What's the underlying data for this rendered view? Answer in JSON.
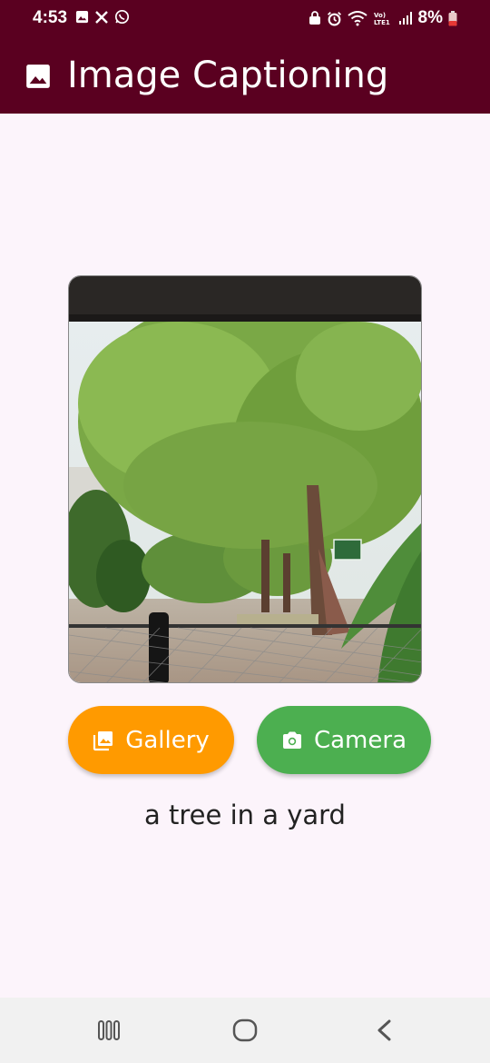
{
  "status_bar": {
    "time": "4:53",
    "battery": "8%",
    "left_icons": [
      "gallery-notification-icon",
      "x-notification-icon",
      "whatsapp-notification-icon"
    ],
    "right_icons": [
      "lock-icon",
      "alarm-icon",
      "wifi-icon",
      "volte-icon",
      "signal-icon",
      "battery-low-icon"
    ],
    "volte_label": "Vo) LTE1"
  },
  "app_bar": {
    "title": "Image Captioning",
    "icon": "image-icon",
    "background": "#5a0020"
  },
  "photo": {
    "description_icon": "selected-photo"
  },
  "buttons": {
    "gallery_label": "Gallery",
    "gallery_icon": "photo-library-icon",
    "gallery_color": "#ff9a00",
    "camera_label": "Camera",
    "camera_icon": "camera-icon",
    "camera_color": "#4caf50"
  },
  "caption": "a tree in a yard",
  "nav_bar": {
    "items": [
      "recent-apps-icon",
      "home-icon",
      "back-icon"
    ]
  }
}
